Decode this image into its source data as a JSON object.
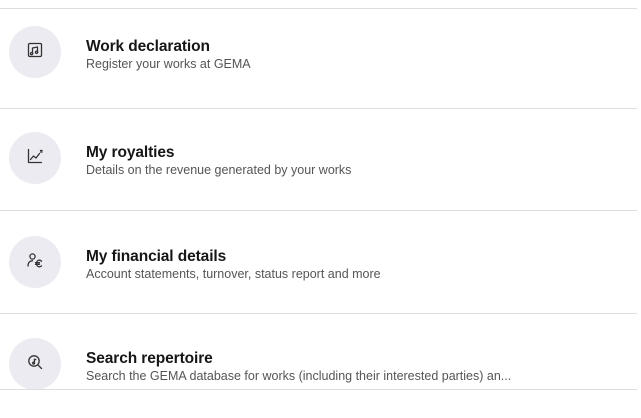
{
  "menu": {
    "items": [
      {
        "title": "Work declaration",
        "description": "Register your works at GEMA",
        "icon": "music-sheet-icon"
      },
      {
        "title": "My royalties",
        "description": "Details on the revenue generated by your works",
        "icon": "revenue-chart-icon"
      },
      {
        "title": "My financial details",
        "description": "Account statements, turnover, status report and more",
        "icon": "person-euro-icon"
      },
      {
        "title": "Search repertoire",
        "description": "Search the GEMA database for works (including their interested parties) an...",
        "icon": "search-music-icon"
      }
    ]
  },
  "colors": {
    "icon_background": "#ecebf1",
    "icon_stroke": "#333333",
    "divider": "#dedede"
  }
}
